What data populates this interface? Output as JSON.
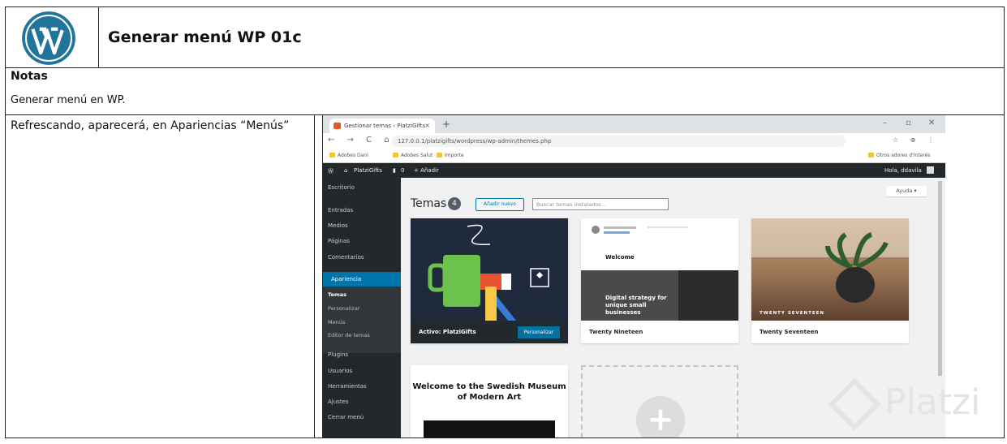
{
  "doc": {
    "title": "Generar menú WP 01c",
    "notes_heading": "Notas",
    "notes_text": "Generar menú en WP.",
    "body_text": "Refrescando, aparecerá, en Apariencias “Menús”",
    "watermark": "Platzi"
  },
  "browser": {
    "tab_title": "Gestionar temas ‹ PlatziGifts",
    "tab_close": "×",
    "new_tab": "+",
    "win_minimize": "–",
    "win_restore": "▫",
    "win_close": "✕",
    "nav": "← → C ⌂",
    "url": "127.0.0.1/platzigifts/wordpress/wp-admin/themes.php",
    "extensions": "☆ ⊕ ⋮",
    "bookmarks": [
      "Adobes Dani",
      "Adobes Salut",
      "Importe"
    ],
    "bookmarks_right": "Otros adores d'Interés"
  },
  "wp": {
    "adminbar_site": "PlatziGifts",
    "adminbar_comments": "0",
    "adminbar_new": "+ Añadir",
    "adminbar_howdy": "Hola, ddavila",
    "menu": {
      "escritorio": "Escritorio",
      "entradas": "Entradas",
      "medios": "Medios",
      "paginas": "Páginas",
      "comentarios": "Comentarios",
      "apariencia": "Apariencia",
      "temas": "Temas",
      "personalizar": "Personalizar",
      "menus": "Menús",
      "editor": "Editor de temas",
      "plugins": "Plugins",
      "usuarios": "Usuarios",
      "herramientas": "Herramientas",
      "ajustes": "Ajustes",
      "cerrar": "Cerrar menú"
    },
    "page_title": "Temas",
    "theme_count": "4",
    "add_new": "Añadir nuevo",
    "search_placeholder": "Buscar temas instalados...",
    "help": "Ayuda ▾",
    "themes": [
      {
        "name": "Activo: PlatziGifts",
        "action": "Personalizar"
      },
      {
        "name": "Twenty Nineteen",
        "welcome": "Welcome",
        "tagline": "Digital strategy for unique small businesses"
      },
      {
        "name": "Twenty Seventeen",
        "overlay": "TWENTY SEVENTEEN"
      }
    ],
    "swedish_title": "Welcome to the Swedish Museum of Modern Art",
    "add_theme_plus": "+"
  },
  "colors": {
    "wp_blue": "#0073aa",
    "admin_dark": "#23282d",
    "active_theme_bg": "#1f2b3d",
    "cup_green": "#6dc24b"
  }
}
